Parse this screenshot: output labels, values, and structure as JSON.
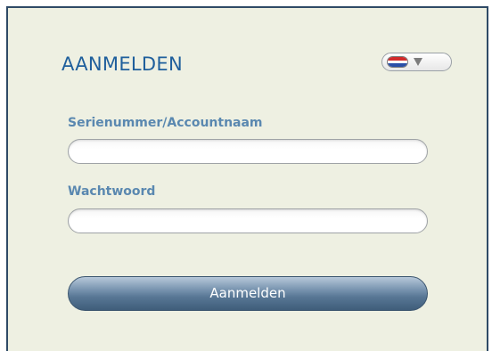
{
  "login": {
    "title": "AANMELDEN",
    "language": {
      "selected_flag": "netherlands-flag",
      "caret_icon": "caret-down-icon"
    },
    "username": {
      "label": "Serienummer/Accountnaam",
      "value": "",
      "placeholder": ""
    },
    "password": {
      "label": "Wachtwoord",
      "value": "",
      "placeholder": ""
    },
    "submit_label": "Aanmelden"
  },
  "colors": {
    "panel_background": "#eef0e2",
    "panel_border": "#2f4a66",
    "title": "#1f5f9c",
    "label": "#5a88b0",
    "button": "#587795"
  }
}
